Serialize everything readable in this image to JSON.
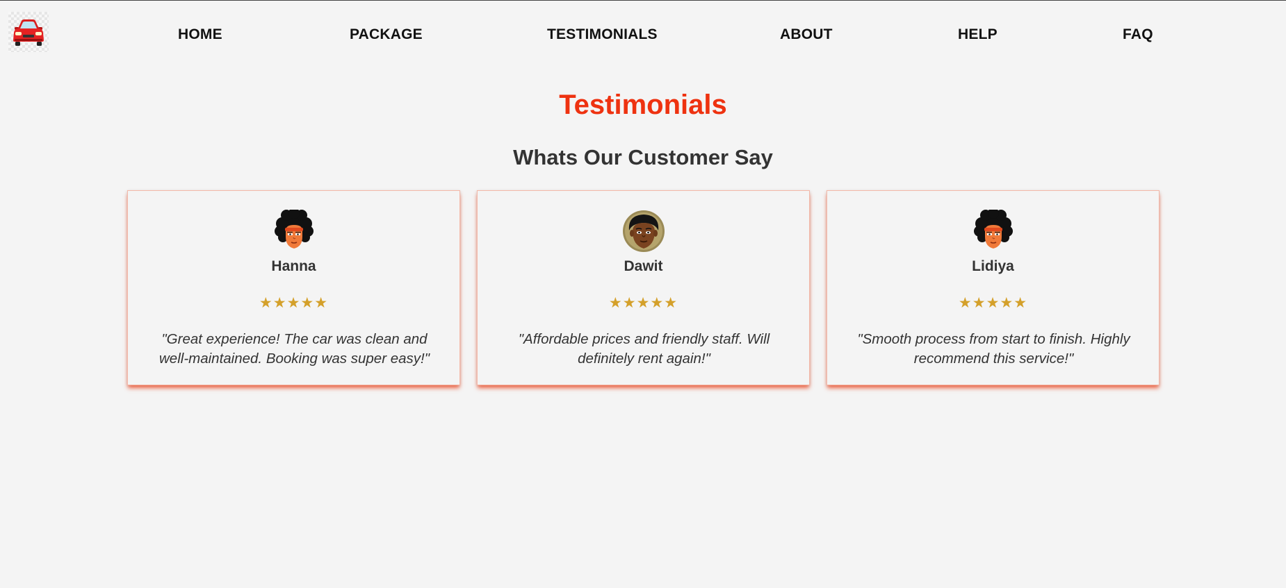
{
  "nav": {
    "logo_icon": "red-car-icon",
    "links": [
      "HOME",
      "PACKAGE",
      "TESTIMONIALS",
      "ABOUT",
      "HELP",
      "FAQ"
    ]
  },
  "page": {
    "title": "Testimonials",
    "subtitle": "Whats Our Customer Say"
  },
  "colors": {
    "accent": "#ee3210",
    "star": "#d4a02a",
    "text": "#333333",
    "background": "#f4f4f4"
  },
  "testimonials": [
    {
      "name": "Hanna",
      "avatar_icon": "afro-woman-avatar-icon",
      "rating": 5,
      "stars": "★★★★★",
      "quote": "\"Great experience! The car was clean and well-maintained. Booking was super easy!\""
    },
    {
      "name": "Dawit",
      "avatar_icon": "man-avatar-icon",
      "rating": 5,
      "stars": "★★★★★",
      "quote": "\"Affordable prices and friendly staff. Will definitely rent again!\""
    },
    {
      "name": "Lidiya",
      "avatar_icon": "afro-woman-avatar-icon",
      "rating": 5,
      "stars": "★★★★★",
      "quote": "\"Smooth process from start to finish. Highly recommend this service!\""
    }
  ]
}
